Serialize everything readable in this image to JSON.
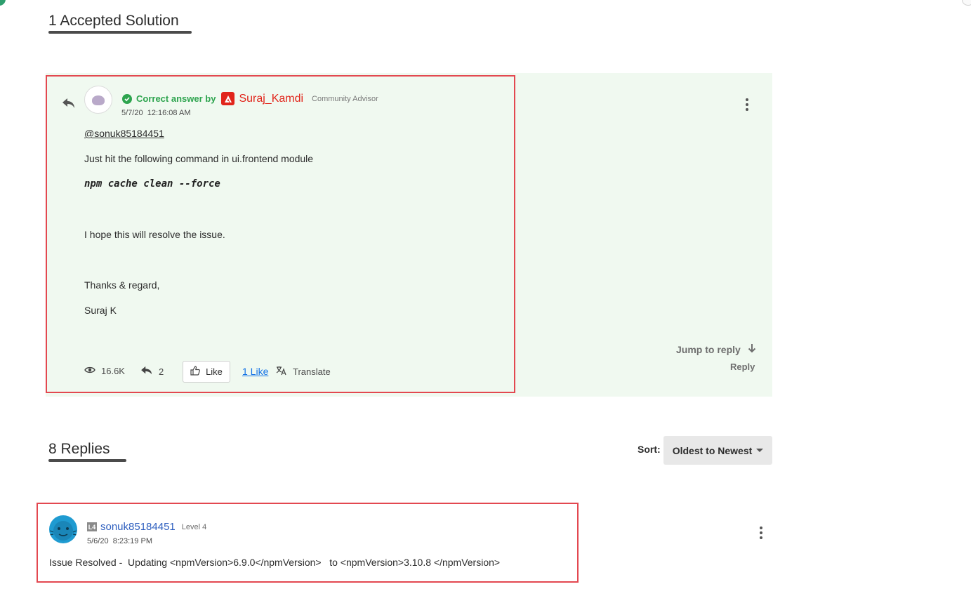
{
  "accepted": {
    "title": "1 Accepted Solution",
    "correct_label": "Correct answer by",
    "author": "Suraj_Kamdi",
    "role": "Community Advisor",
    "date": "5/7/20",
    "time": "12:16:08 AM",
    "body": {
      "mention": "@sonuk85184451",
      "line1": "Just hit the following command in ui.frontend module",
      "code": "npm cache clean --force",
      "line2": "I hope this will resolve the issue.",
      "line3": "Thanks & regard,",
      "line4": "Suraj K"
    },
    "views": "16.6K",
    "replies": "2",
    "like_label": "Like",
    "likes_count": "1 Like",
    "translate_label": "Translate",
    "jump_label": "Jump to reply",
    "reply_label": "Reply"
  },
  "replies_section": {
    "title": "8 Replies",
    "sort_label": "Sort:",
    "sort_value": "Oldest to Newest"
  },
  "reply1": {
    "level_badge": "L4",
    "user": "sonuk85184451",
    "level": "Level 4",
    "date": "5/6/20",
    "time": "8:23:19 PM",
    "text": "Issue Resolved -  Updating <npmVersion>6.9.0</npmVersion>   to <npmVersion>3.10.8 </npmVersion>"
  },
  "colors": {
    "accent_green": "#2da44e",
    "adobe_red": "#e1251b",
    "highlight_border": "#e34850",
    "link_blue": "#1473e6",
    "solution_bg": "#f0f9f0"
  }
}
